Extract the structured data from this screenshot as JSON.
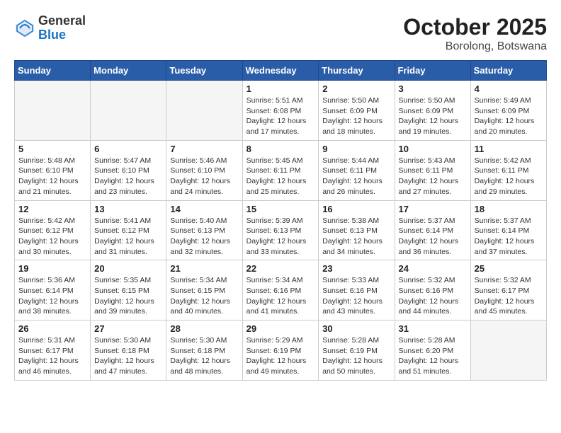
{
  "header": {
    "logo_general": "General",
    "logo_blue": "Blue",
    "month": "October 2025",
    "location": "Borolong, Botswana"
  },
  "weekdays": [
    "Sunday",
    "Monday",
    "Tuesday",
    "Wednesday",
    "Thursday",
    "Friday",
    "Saturday"
  ],
  "weeks": [
    [
      {
        "day": "",
        "info": ""
      },
      {
        "day": "",
        "info": ""
      },
      {
        "day": "",
        "info": ""
      },
      {
        "day": "1",
        "info": "Sunrise: 5:51 AM\nSunset: 6:08 PM\nDaylight: 12 hours and 17 minutes."
      },
      {
        "day": "2",
        "info": "Sunrise: 5:50 AM\nSunset: 6:09 PM\nDaylight: 12 hours and 18 minutes."
      },
      {
        "day": "3",
        "info": "Sunrise: 5:50 AM\nSunset: 6:09 PM\nDaylight: 12 hours and 19 minutes."
      },
      {
        "day": "4",
        "info": "Sunrise: 5:49 AM\nSunset: 6:09 PM\nDaylight: 12 hours and 20 minutes."
      }
    ],
    [
      {
        "day": "5",
        "info": "Sunrise: 5:48 AM\nSunset: 6:10 PM\nDaylight: 12 hours and 21 minutes."
      },
      {
        "day": "6",
        "info": "Sunrise: 5:47 AM\nSunset: 6:10 PM\nDaylight: 12 hours and 23 minutes."
      },
      {
        "day": "7",
        "info": "Sunrise: 5:46 AM\nSunset: 6:10 PM\nDaylight: 12 hours and 24 minutes."
      },
      {
        "day": "8",
        "info": "Sunrise: 5:45 AM\nSunset: 6:11 PM\nDaylight: 12 hours and 25 minutes."
      },
      {
        "day": "9",
        "info": "Sunrise: 5:44 AM\nSunset: 6:11 PM\nDaylight: 12 hours and 26 minutes."
      },
      {
        "day": "10",
        "info": "Sunrise: 5:43 AM\nSunset: 6:11 PM\nDaylight: 12 hours and 27 minutes."
      },
      {
        "day": "11",
        "info": "Sunrise: 5:42 AM\nSunset: 6:11 PM\nDaylight: 12 hours and 29 minutes."
      }
    ],
    [
      {
        "day": "12",
        "info": "Sunrise: 5:42 AM\nSunset: 6:12 PM\nDaylight: 12 hours and 30 minutes."
      },
      {
        "day": "13",
        "info": "Sunrise: 5:41 AM\nSunset: 6:12 PM\nDaylight: 12 hours and 31 minutes."
      },
      {
        "day": "14",
        "info": "Sunrise: 5:40 AM\nSunset: 6:13 PM\nDaylight: 12 hours and 32 minutes."
      },
      {
        "day": "15",
        "info": "Sunrise: 5:39 AM\nSunset: 6:13 PM\nDaylight: 12 hours and 33 minutes."
      },
      {
        "day": "16",
        "info": "Sunrise: 5:38 AM\nSunset: 6:13 PM\nDaylight: 12 hours and 34 minutes."
      },
      {
        "day": "17",
        "info": "Sunrise: 5:37 AM\nSunset: 6:14 PM\nDaylight: 12 hours and 36 minutes."
      },
      {
        "day": "18",
        "info": "Sunrise: 5:37 AM\nSunset: 6:14 PM\nDaylight: 12 hours and 37 minutes."
      }
    ],
    [
      {
        "day": "19",
        "info": "Sunrise: 5:36 AM\nSunset: 6:14 PM\nDaylight: 12 hours and 38 minutes."
      },
      {
        "day": "20",
        "info": "Sunrise: 5:35 AM\nSunset: 6:15 PM\nDaylight: 12 hours and 39 minutes."
      },
      {
        "day": "21",
        "info": "Sunrise: 5:34 AM\nSunset: 6:15 PM\nDaylight: 12 hours and 40 minutes."
      },
      {
        "day": "22",
        "info": "Sunrise: 5:34 AM\nSunset: 6:16 PM\nDaylight: 12 hours and 41 minutes."
      },
      {
        "day": "23",
        "info": "Sunrise: 5:33 AM\nSunset: 6:16 PM\nDaylight: 12 hours and 43 minutes."
      },
      {
        "day": "24",
        "info": "Sunrise: 5:32 AM\nSunset: 6:16 PM\nDaylight: 12 hours and 44 minutes."
      },
      {
        "day": "25",
        "info": "Sunrise: 5:32 AM\nSunset: 6:17 PM\nDaylight: 12 hours and 45 minutes."
      }
    ],
    [
      {
        "day": "26",
        "info": "Sunrise: 5:31 AM\nSunset: 6:17 PM\nDaylight: 12 hours and 46 minutes."
      },
      {
        "day": "27",
        "info": "Sunrise: 5:30 AM\nSunset: 6:18 PM\nDaylight: 12 hours and 47 minutes."
      },
      {
        "day": "28",
        "info": "Sunrise: 5:30 AM\nSunset: 6:18 PM\nDaylight: 12 hours and 48 minutes."
      },
      {
        "day": "29",
        "info": "Sunrise: 5:29 AM\nSunset: 6:19 PM\nDaylight: 12 hours and 49 minutes."
      },
      {
        "day": "30",
        "info": "Sunrise: 5:28 AM\nSunset: 6:19 PM\nDaylight: 12 hours and 50 minutes."
      },
      {
        "day": "31",
        "info": "Sunrise: 5:28 AM\nSunset: 6:20 PM\nDaylight: 12 hours and 51 minutes."
      },
      {
        "day": "",
        "info": ""
      }
    ]
  ]
}
